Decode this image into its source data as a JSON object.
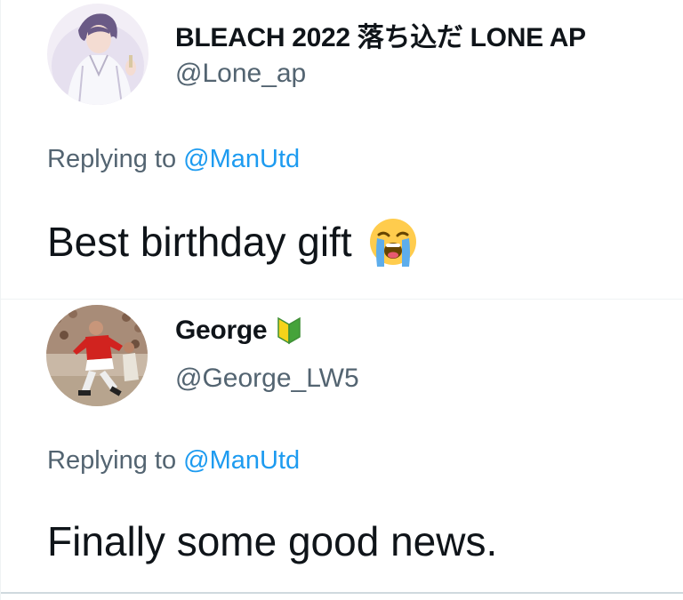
{
  "tweets": [
    {
      "display_name": "BLEACH 2022 落ち込だ LONE AP",
      "handle": "@Lone_ap",
      "reply_prefix": "Replying to",
      "reply_mention": "@ManUtd",
      "text": "Best birthday gift",
      "emoji": "loudly-crying-face-icon"
    },
    {
      "display_name": "George",
      "badge": "beginner-badge-icon",
      "handle": "@George_LW5",
      "reply_prefix": "Replying to",
      "reply_mention": "@ManUtd",
      "text": "Finally some good news."
    }
  ],
  "colors": {
    "text_primary": "#0f1419",
    "text_secondary": "#536471",
    "link": "#1d9bf0",
    "divider": "#eff3f4"
  }
}
